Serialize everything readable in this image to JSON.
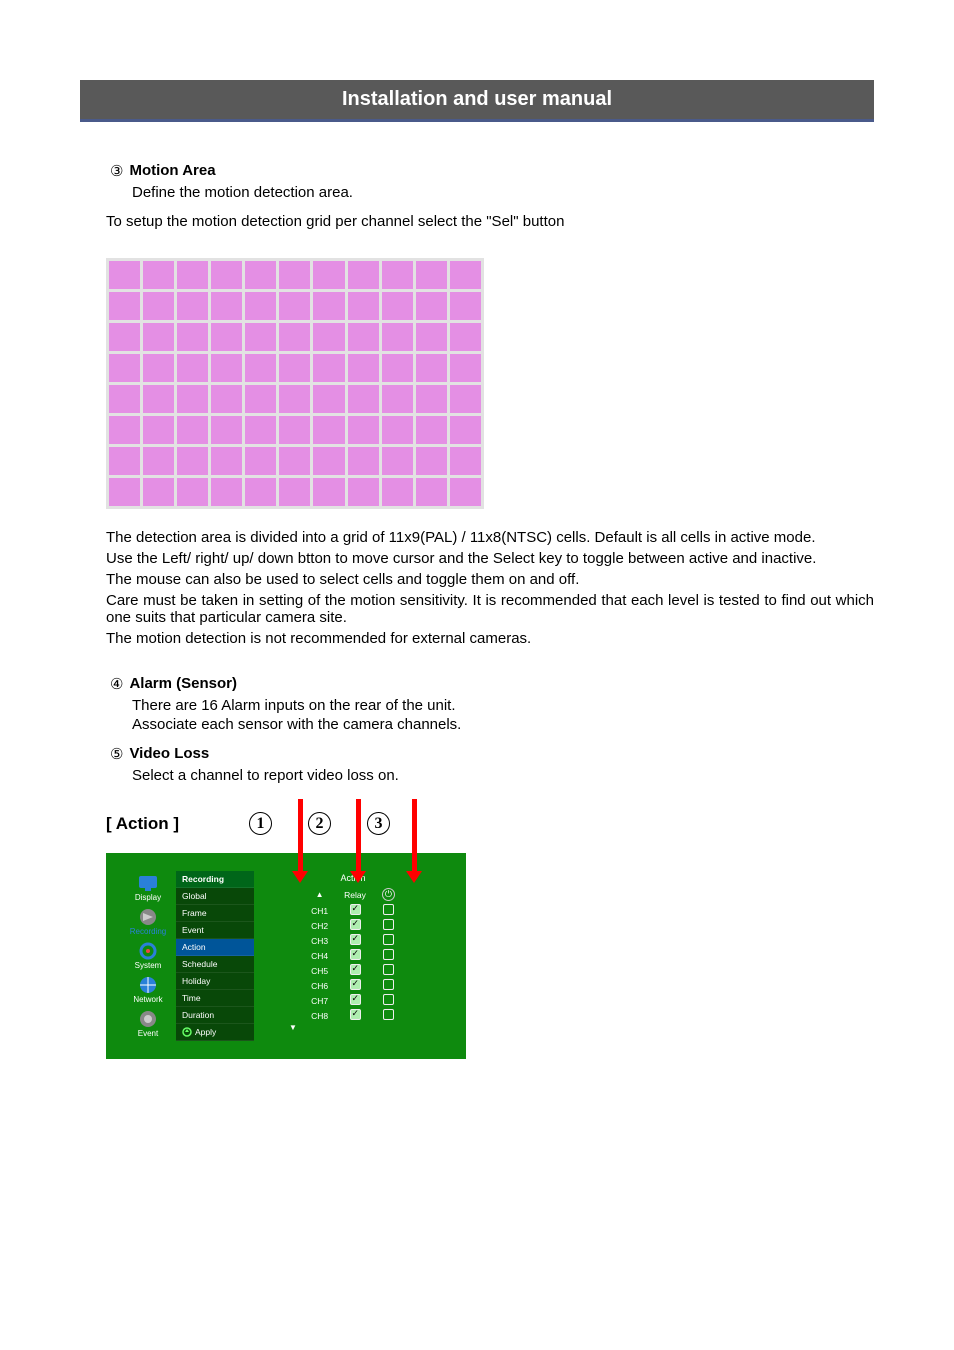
{
  "header": {
    "title": "Installation and user manual"
  },
  "section3": {
    "num": "③",
    "title": "Motion Area",
    "desc": "Define the motion detection area.",
    "setup_text": "To setup the motion detection grid per channel select the \"Sel\" button"
  },
  "grid": {
    "rows": 8,
    "cols": 11
  },
  "after_grid": {
    "p1": "The detection area is divided into a grid of 11x9(PAL) / 11x8(NTSC) cells. Default is all cells in active mode.",
    "p2": "Use the Left/ right/ up/ down btton to move cursor and the Select key to toggle between active and inactive.",
    "p3": "The mouse can also be used to select cells and toggle them on and off.",
    "p4": "Care must be taken in setting of the motion sensitivity. It is recommended that each level is tested to find out which one suits that particular camera site.",
    "p5": "The motion detection is not recommended for external cameras."
  },
  "section4": {
    "num": "④",
    "title": "Alarm (Sensor)",
    "line1": "There are 16 Alarm inputs on the rear of the unit.",
    "line2": "Associate each sensor with the camera channels."
  },
  "section5": {
    "num": "⑤",
    "title": "Video Loss",
    "desc": "Select a channel to report video loss on."
  },
  "action": {
    "heading": "[ Action ]",
    "annotations": [
      "1",
      "2",
      "3"
    ],
    "panel_title": "Action",
    "sidebar": [
      {
        "label": "Display"
      },
      {
        "label": "Recording"
      },
      {
        "label": "System"
      },
      {
        "label": "Network"
      },
      {
        "label": "Event"
      }
    ],
    "submenu_top": "Recording",
    "submenu": [
      "Global",
      "Frame",
      "Event",
      "Action",
      "Schedule",
      "Holiday",
      "Time",
      "Duration"
    ],
    "apply": "Apply",
    "highlighted": "Action",
    "table_headers": [
      "",
      "Relay",
      ""
    ],
    "table_rows": [
      {
        "ch": "CH1",
        "relay": true,
        "extra": false
      },
      {
        "ch": "CH2",
        "relay": true,
        "extra": false
      },
      {
        "ch": "CH3",
        "relay": true,
        "extra": false
      },
      {
        "ch": "CH4",
        "relay": true,
        "extra": false
      },
      {
        "ch": "CH5",
        "relay": true,
        "extra": false
      },
      {
        "ch": "CH6",
        "relay": true,
        "extra": false
      },
      {
        "ch": "CH7",
        "relay": true,
        "extra": false
      },
      {
        "ch": "CH8",
        "relay": true,
        "extra": false
      }
    ]
  }
}
